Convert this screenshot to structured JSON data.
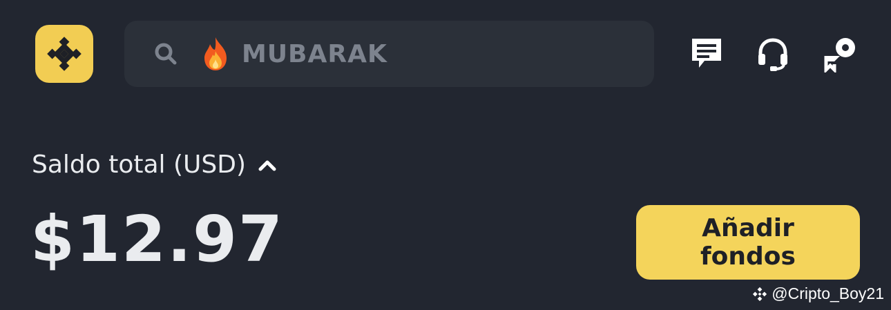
{
  "app": {
    "logo_icon": "binance-logo-icon",
    "brand_color": "#f2cd53"
  },
  "search": {
    "icon": "search-icon",
    "trend_icon": "fire-icon",
    "trending_text": "MUBARAK"
  },
  "header_icons": [
    "messages-icon",
    "headset-support-icon",
    "share-referral-icon"
  ],
  "balance": {
    "label": "Saldo total (USD)",
    "toggle_icon": "chevron-up-icon",
    "amount": "$12.97"
  },
  "actions": {
    "add_funds_label": "Añadir fondos"
  },
  "watermark": {
    "icon": "binance-mini-logo-icon",
    "handle": "@Cripto_Boy21"
  }
}
